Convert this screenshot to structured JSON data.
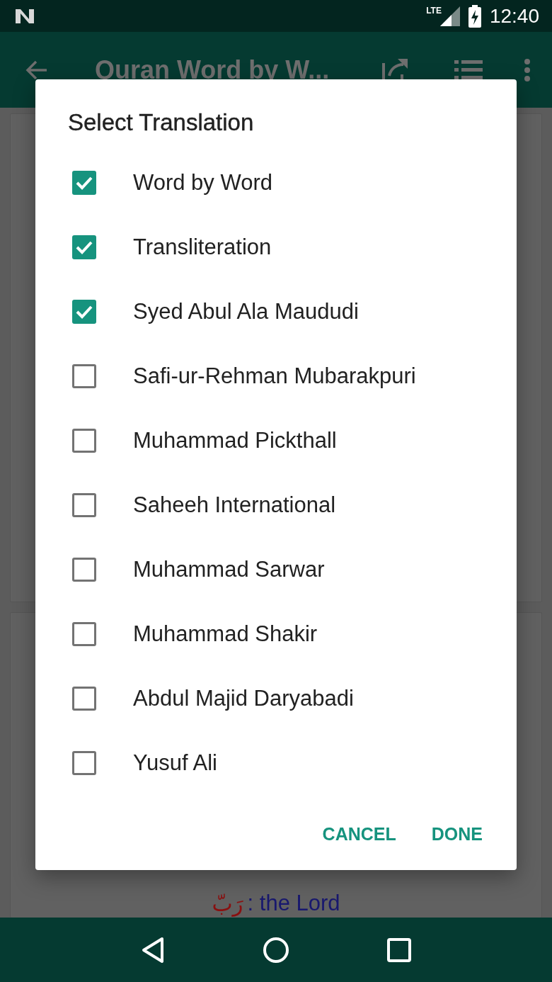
{
  "status_bar": {
    "network": "LTE",
    "time": "12:40"
  },
  "app_bar": {
    "title": "Quran Word by W..."
  },
  "background": {
    "word_arabic": "رَبّ",
    "word_meaning": ": the Lord"
  },
  "dialog": {
    "title": "Select Translation",
    "options": [
      {
        "label": "Word by Word",
        "checked": true
      },
      {
        "label": "Transliteration",
        "checked": true
      },
      {
        "label": "Syed Abul Ala Maududi",
        "checked": true
      },
      {
        "label": "Safi-ur-Rehman Mubarakpuri",
        "checked": false
      },
      {
        "label": "Muhammad Pickthall",
        "checked": false
      },
      {
        "label": "Saheeh International",
        "checked": false
      },
      {
        "label": "Muhammad Sarwar",
        "checked": false
      },
      {
        "label": "Muhammad Shakir",
        "checked": false
      },
      {
        "label": "Abdul Majid Daryabadi",
        "checked": false
      },
      {
        "label": "Yusuf Ali",
        "checked": false
      }
    ],
    "buttons": [
      {
        "label": "CANCEL"
      },
      {
        "label": "DONE"
      }
    ]
  }
}
